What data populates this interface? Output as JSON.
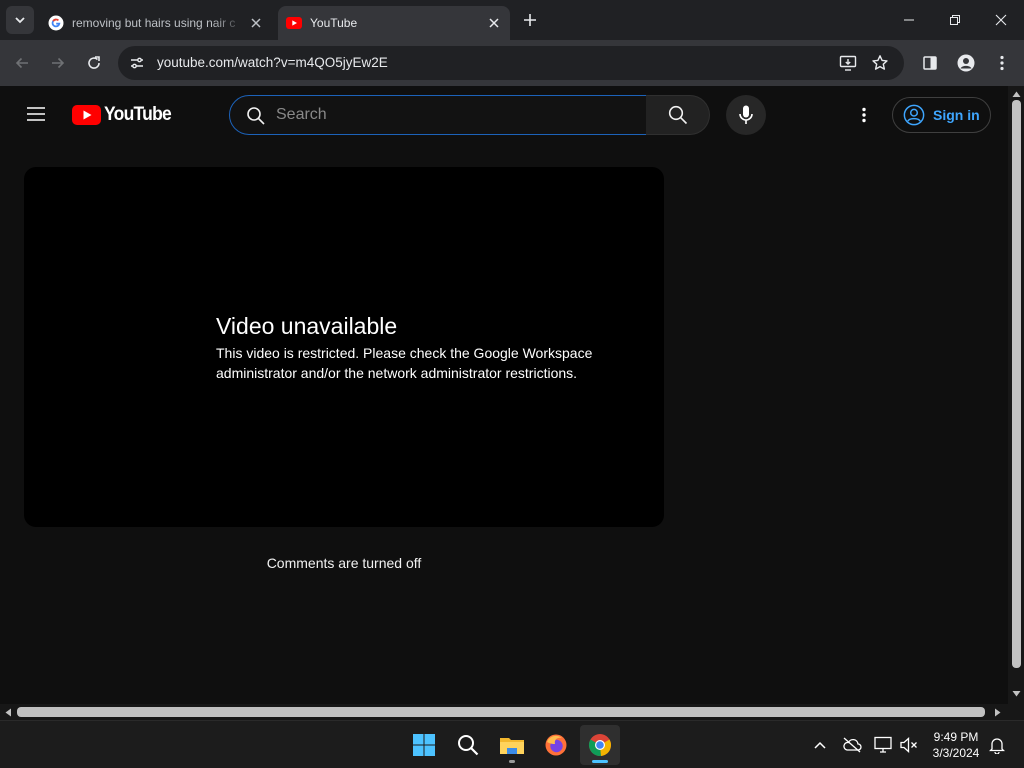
{
  "browser": {
    "tabs": [
      {
        "title": "removing but hairs using nair c",
        "favicon": "google-g-icon",
        "active": false
      },
      {
        "title": "YouTube",
        "favicon": "youtube-icon",
        "active": true
      }
    ],
    "url": "youtube.com/watch?v=m4QO5jyEw2E"
  },
  "youtube": {
    "logo_text": "YouTube",
    "search_placeholder": "Search",
    "sign_in_label": "Sign in",
    "error_title": "Video unavailable",
    "error_message": "This video is restricted. Please check the Google Workspace administrator and/or the network administrator restrictions.",
    "comments_status": "Comments are turned off"
  },
  "taskbar": {
    "time": "9:49 PM",
    "date": "3/3/2024",
    "pinned": [
      "windows-start-icon",
      "search-icon",
      "file-explorer-icon",
      "firefox-icon",
      "chrome-icon"
    ]
  },
  "colors": {
    "youtube_red": "#ff0000",
    "signin_blue": "#3ea6ff",
    "search_focus_border": "#1c62b9",
    "page_bg": "#0f0f0f"
  }
}
